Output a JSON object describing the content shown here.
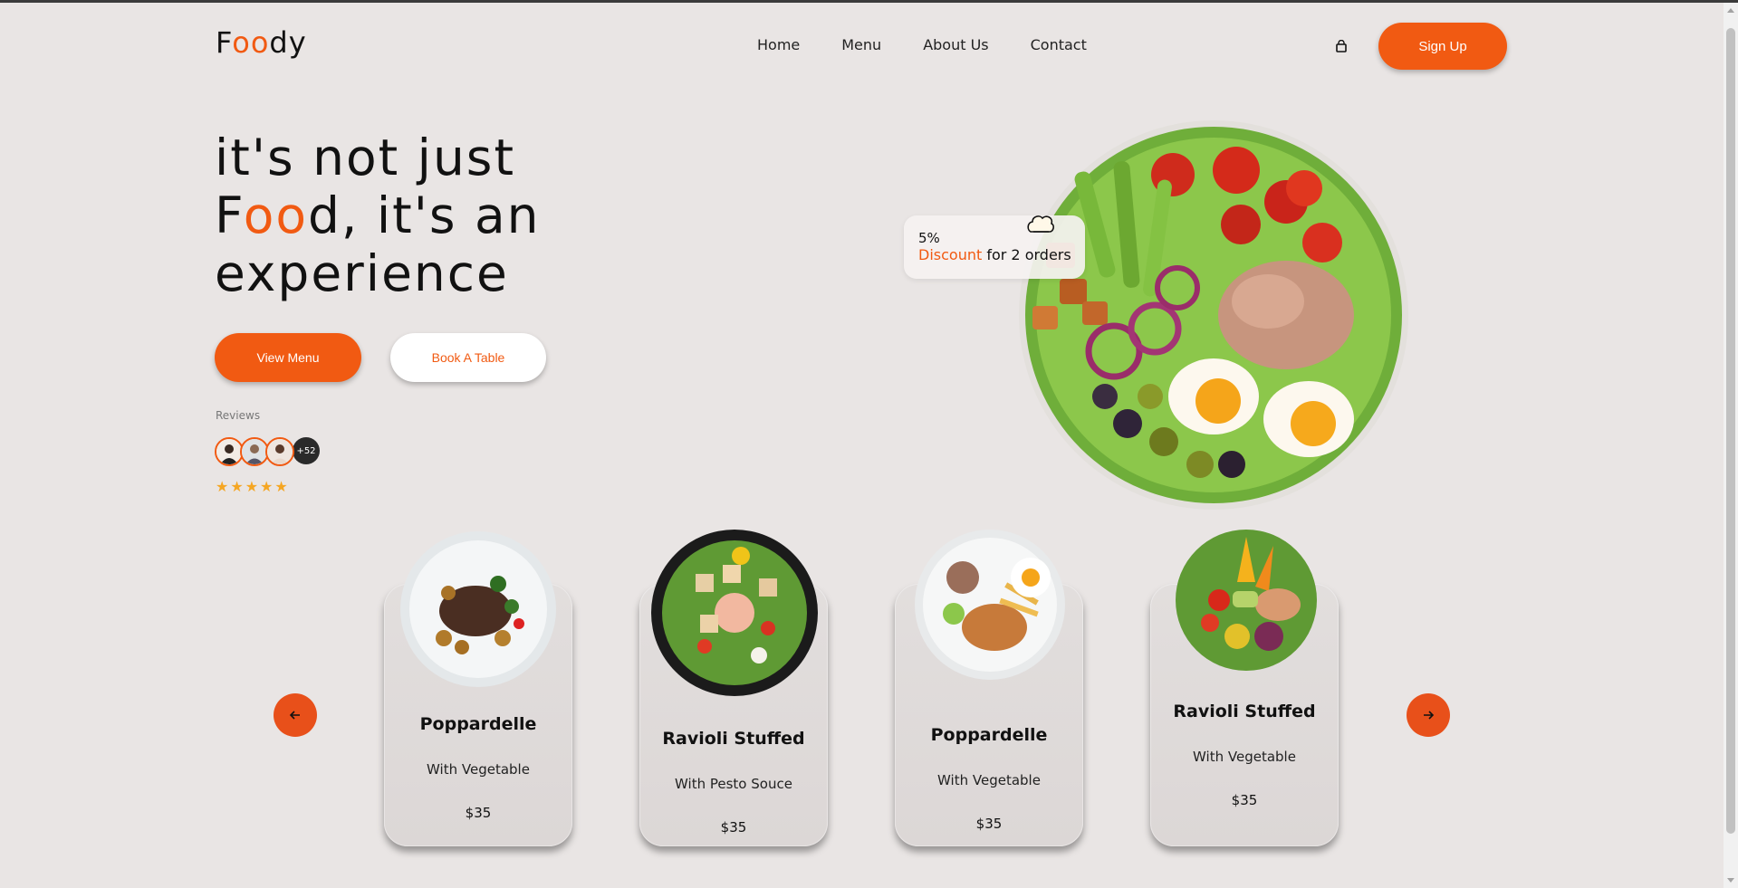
{
  "logo": {
    "part1": "F",
    "part2": "oo",
    "part3": "dy"
  },
  "nav": {
    "items": [
      "Home",
      "Menu",
      "About Us",
      "Contact"
    ]
  },
  "header": {
    "signup_label": "Sign Up"
  },
  "hero": {
    "line1": "it's not just",
    "line2_a": "F",
    "line2_b": "oo",
    "line2_c": "d, it's an",
    "line3": "experience",
    "view_menu_label": "View Menu",
    "book_table_label": "Book A Table",
    "reviews_label": "Reviews",
    "reviews_more": "+52",
    "rating_stars": 5
  },
  "discount": {
    "percent": "5%",
    "word": "Discount",
    "rest": "for 2 orders"
  },
  "menu_cards": [
    {
      "title": "Poppardelle",
      "subtitle": "With Vegetable",
      "price": "$35"
    },
    {
      "title": "Ravioli Stuffed",
      "subtitle": "With Pesto Souce",
      "price": "$35"
    },
    {
      "title": "Poppardelle",
      "subtitle": "With Vegetable",
      "price": "$35"
    },
    {
      "title": "Ravioli Stuffed",
      "subtitle": "With Vegetable",
      "price": "$35"
    }
  ],
  "colors": {
    "accent": "#f15a12",
    "background": "#e9e5e4",
    "star": "#f5a623"
  },
  "icons": [
    "cart-icon",
    "chef-icon",
    "arrow-left-icon",
    "arrow-right-icon",
    "star-icon"
  ]
}
